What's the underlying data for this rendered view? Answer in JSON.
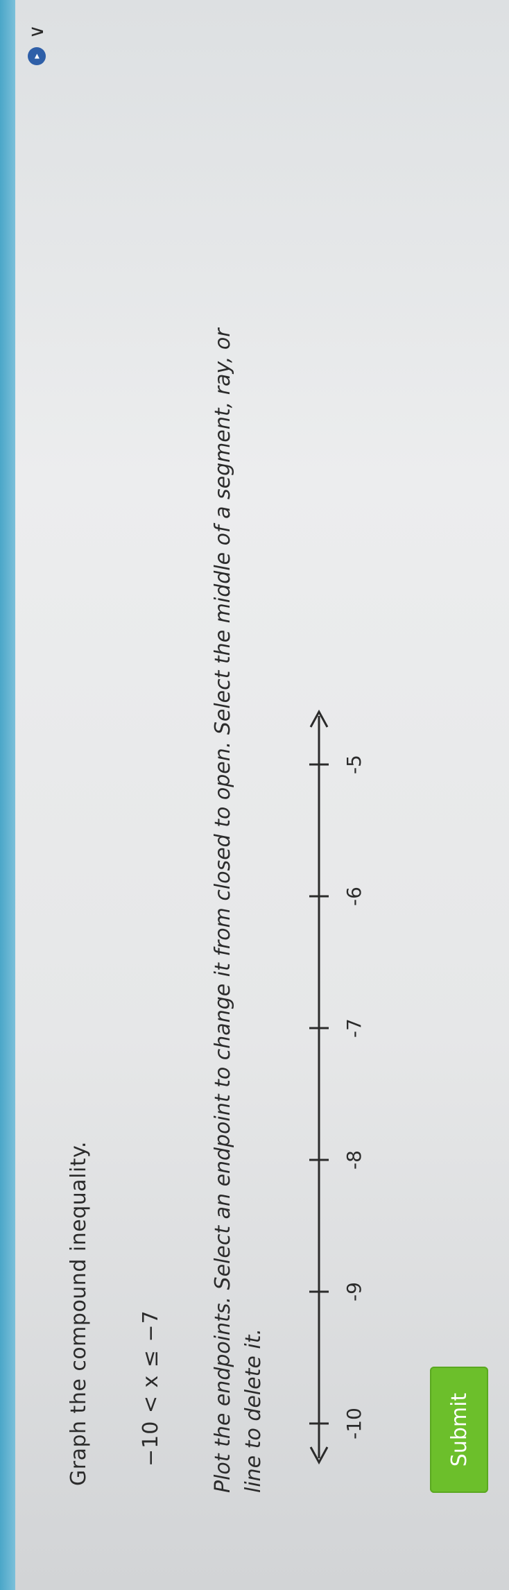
{
  "prompt": {
    "title": "Graph the compound inequality.",
    "inequality": "−10 < x ≤ −7",
    "instructions": "Plot the endpoints. Select an endpoint to change it from closed to open. Select the middle of a segment, ray, or line to delete it."
  },
  "number_line": {
    "ticks": [
      "-10",
      "-9",
      "-8",
      "-7",
      "-6",
      "-5"
    ],
    "left_arrow": "left-arrow",
    "right_arrow": "right-arrow"
  },
  "actions": {
    "submit_label": "Submit"
  },
  "icons": {
    "help": "help-icon",
    "chevron": "chevron-icon"
  },
  "colors": {
    "submit_bg": "#6cbf2b",
    "accent": "#2e5fa8",
    "header": "#4aa6c8"
  }
}
